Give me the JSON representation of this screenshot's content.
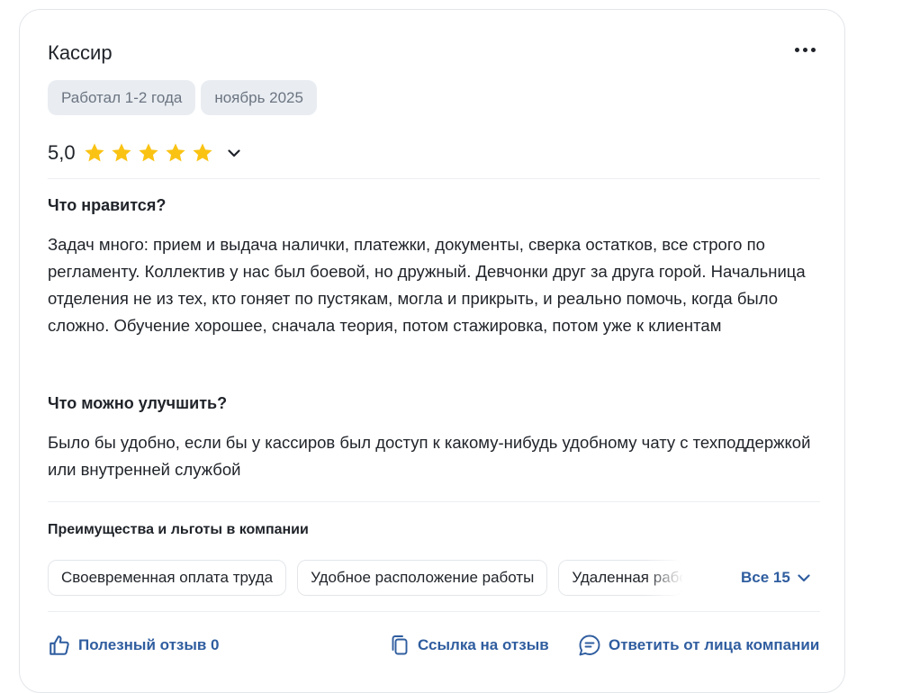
{
  "review": {
    "title": "Кассир",
    "work_period": "Работал 1-2 года",
    "date": "ноябрь 2025",
    "rating": "5,0",
    "rating_stars": 5,
    "star_color": "#fac314",
    "likes_heading": "Что нравится?",
    "likes_text": "Задач много: прием и выдача налички, платежки, документы, сверка остатков, все строго по регламенту. Коллектив у нас был боевой, но дружный. Девчонки друг за друга горой. Начальница отделения не из тех, кто гоняет по пустякам, могла и прикрыть, и реально помочь, когда было сложно. Обучение хорошее, сначала теория, потом стажировка, потом уже к клиентам",
    "improve_heading": "Что можно улучшить?",
    "improve_text": "Было бы удобно, если бы у кассиров был доступ к какому-нибудь удобному чату с техподдержкой или внутренней службой"
  },
  "benefits": {
    "heading": "Преимущества и льготы в компании",
    "items": [
      "Своевременная оплата труда",
      "Удобное расположение работы",
      "Удаленная работа"
    ],
    "all_label": "Все 15"
  },
  "footer": {
    "useful_label": "Полезный отзыв 0",
    "link_label": "Ссылка на отзыв",
    "reply_label": "Ответить от лица компании"
  },
  "colors": {
    "accent": "#2f5d9f",
    "text": "#1f2329",
    "chip_bg": "#e9edf2"
  },
  "icons": [
    "more-icon",
    "star-icon",
    "chevron-down-icon",
    "thumbs-up-icon",
    "copy-link-icon",
    "chat-icon"
  ]
}
